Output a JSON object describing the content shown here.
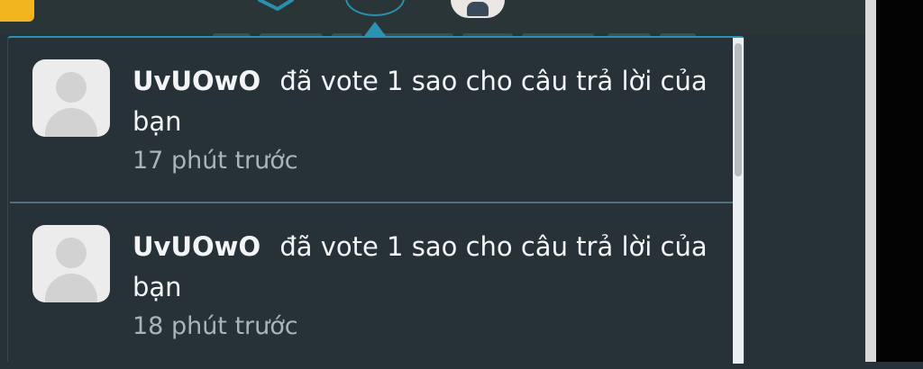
{
  "notifications": [
    {
      "username": "UvUOwO",
      "message": "đã vote 1 sao cho câu trả lời của bạn",
      "time": "17 phút trước"
    },
    {
      "username": "UvUOwO",
      "message": "đã vote 1 sao cho câu trả lời của bạn",
      "time": "18 phút trước"
    }
  ],
  "colors": {
    "background": "#263238",
    "accent": "#2d91b0",
    "logo": "#f2b51f",
    "text": "#f2f4f5",
    "muted_text": "#aab4b8"
  },
  "icons": [
    "logo",
    "send-icon",
    "notification-bell-icon",
    "user-avatar-icon",
    "default-avatar-icon"
  ]
}
